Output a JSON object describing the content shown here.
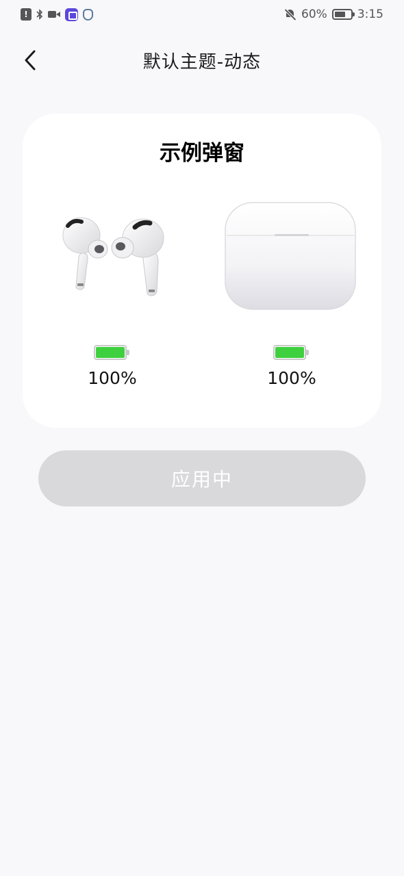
{
  "status_bar": {
    "battery_percent": "60%",
    "time": "3:15",
    "left_icons": [
      "alert-icon",
      "bluetooth-icon",
      "video-icon",
      "app-icon",
      "shield-icon"
    ],
    "right_icons": [
      "bell-off-icon",
      "battery-icon"
    ]
  },
  "header": {
    "title": "默认主题-动态",
    "back_icon": "chevron-left-icon"
  },
  "popup": {
    "title": "示例弹窗",
    "devices": [
      {
        "name": "earbuds",
        "battery": "100%",
        "battery_level": 1.0
      },
      {
        "name": "charging-case",
        "battery": "100%",
        "battery_level": 1.0
      }
    ]
  },
  "apply_button": {
    "label": "应用中"
  },
  "colors": {
    "background": "#f8f7fa",
    "card": "#ffffff",
    "battery_green": "#3fd03f",
    "button_disabled": "#d9d8da"
  }
}
